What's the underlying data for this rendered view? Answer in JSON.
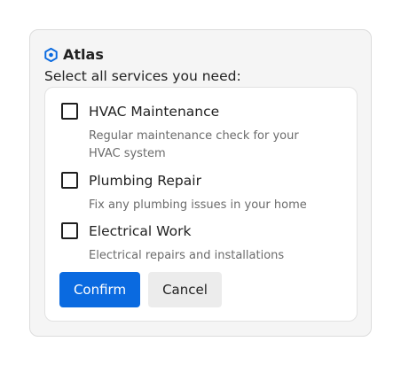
{
  "app": {
    "name": "Atlas",
    "icon": "hexagon-logo-icon",
    "accent": "#0a6ae0"
  },
  "prompt": "Select all services you need:",
  "services": [
    {
      "label": "HVAC Maintenance",
      "description": "Regular maintenance check for your HVAC system",
      "checked": false
    },
    {
      "label": "Plumbing Repair",
      "description": "Fix any plumbing issues in your home",
      "checked": false
    },
    {
      "label": "Electrical Work",
      "description": "Electrical repairs and installations",
      "checked": false
    }
  ],
  "actions": {
    "confirm_label": "Confirm",
    "cancel_label": "Cancel"
  }
}
